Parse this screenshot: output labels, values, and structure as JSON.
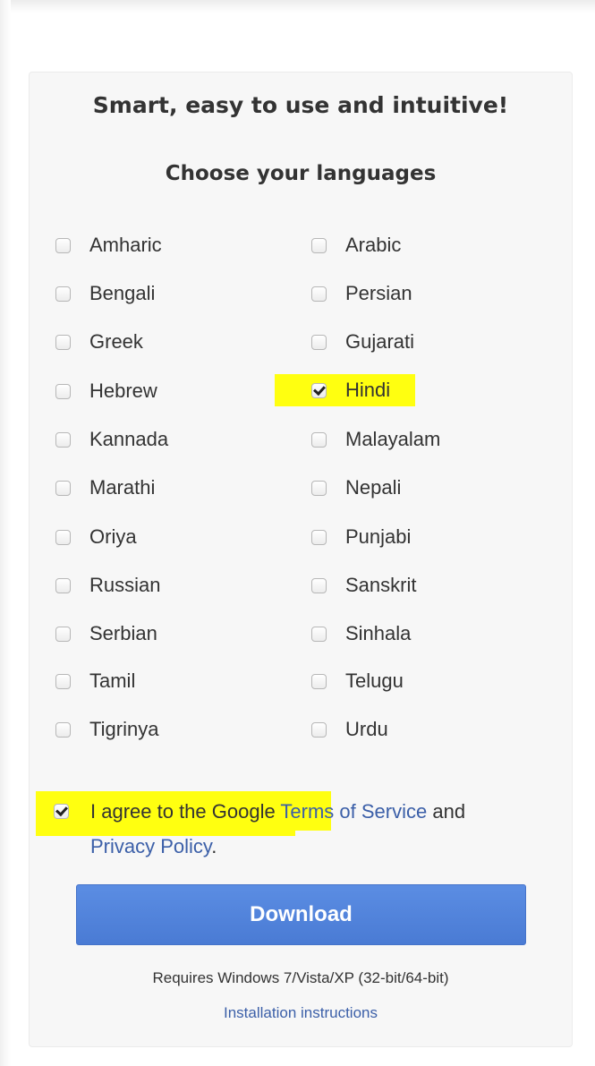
{
  "headline": "Smart, easy to use and intuitive!",
  "subheading": "Choose your languages",
  "languages": {
    "left": [
      {
        "label": "Amharic",
        "checked": false
      },
      {
        "label": "Bengali",
        "checked": false
      },
      {
        "label": "Greek",
        "checked": false
      },
      {
        "label": "Hebrew",
        "checked": false
      },
      {
        "label": "Kannada",
        "checked": false
      },
      {
        "label": "Marathi",
        "checked": false
      },
      {
        "label": "Oriya",
        "checked": false
      },
      {
        "label": "Russian",
        "checked": false
      },
      {
        "label": "Serbian",
        "checked": false
      },
      {
        "label": "Tamil",
        "checked": false
      },
      {
        "label": "Tigrinya",
        "checked": false
      }
    ],
    "right": [
      {
        "label": "Arabic",
        "checked": false
      },
      {
        "label": "Persian",
        "checked": false
      },
      {
        "label": "Gujarati",
        "checked": false
      },
      {
        "label": "Hindi",
        "checked": true
      },
      {
        "label": "Malayalam",
        "checked": false
      },
      {
        "label": "Nepali",
        "checked": false
      },
      {
        "label": "Punjabi",
        "checked": false
      },
      {
        "label": "Sanskrit",
        "checked": false
      },
      {
        "label": "Sinhala",
        "checked": false
      },
      {
        "label": "Telugu",
        "checked": false
      },
      {
        "label": "Urdu",
        "checked": false
      }
    ]
  },
  "agreement": {
    "checked": true,
    "prefix": "I agree to the Google ",
    "terms_link": "Terms of Service",
    "and_text": " and",
    "privacy_link": "Privacy Policy",
    "period": "."
  },
  "download_label": "Download",
  "requirements": "Requires Windows 7/Vista/XP (32-bit/64-bit)",
  "install_link": "Installation instructions",
  "colors": {
    "highlight": "#ffff10",
    "link": "#3b5fa8",
    "button": "#4f81d9",
    "card_background": "#f7f7f7"
  }
}
